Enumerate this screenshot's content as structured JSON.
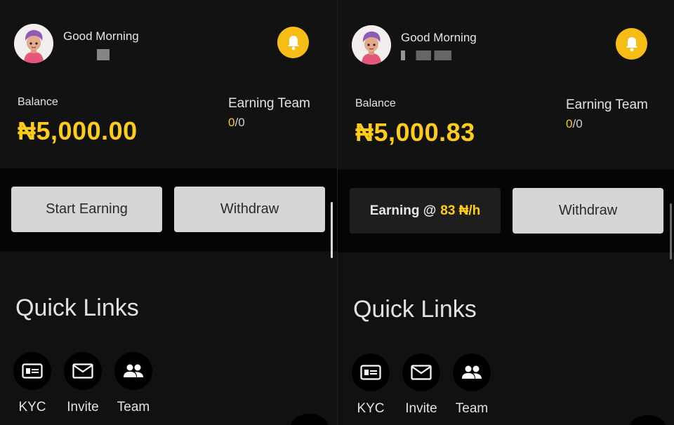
{
  "left": {
    "greeting": "Good Morning",
    "balance_label": "Balance",
    "balance_value": "₦5,000.00",
    "team_label": "Earning Team",
    "team_current": "0",
    "team_separator": "/",
    "team_total": "0",
    "primary_button": "Start Earning",
    "withdraw_button": "Withdraw",
    "quick_links_title": "Quick Links",
    "quick_links": [
      {
        "label": "KYC",
        "icon": "id-card-icon"
      },
      {
        "label": "Invite",
        "icon": "mail-icon"
      },
      {
        "label": "Team",
        "icon": "people-icon"
      }
    ]
  },
  "right": {
    "greeting": "Good Morning",
    "balance_label": "Balance",
    "balance_value": "₦5,000.83",
    "team_label": "Earning Team",
    "team_current": "0",
    "team_separator": "/",
    "team_total": "0",
    "earning_prefix": "Earning @",
    "earning_rate": "83 ₦/h",
    "withdraw_button": "Withdraw",
    "quick_links_title": "Quick Links",
    "quick_links": [
      {
        "label": "KYC",
        "icon": "id-card-icon"
      },
      {
        "label": "Invite",
        "icon": "mail-icon"
      },
      {
        "label": "Team",
        "icon": "people-icon"
      }
    ]
  },
  "colors": {
    "accent": "#ffcc1a",
    "bell": "#f6bd16",
    "button_light": "#d6d6d6",
    "button_dark": "#1e1e1e",
    "background": "#111111"
  }
}
